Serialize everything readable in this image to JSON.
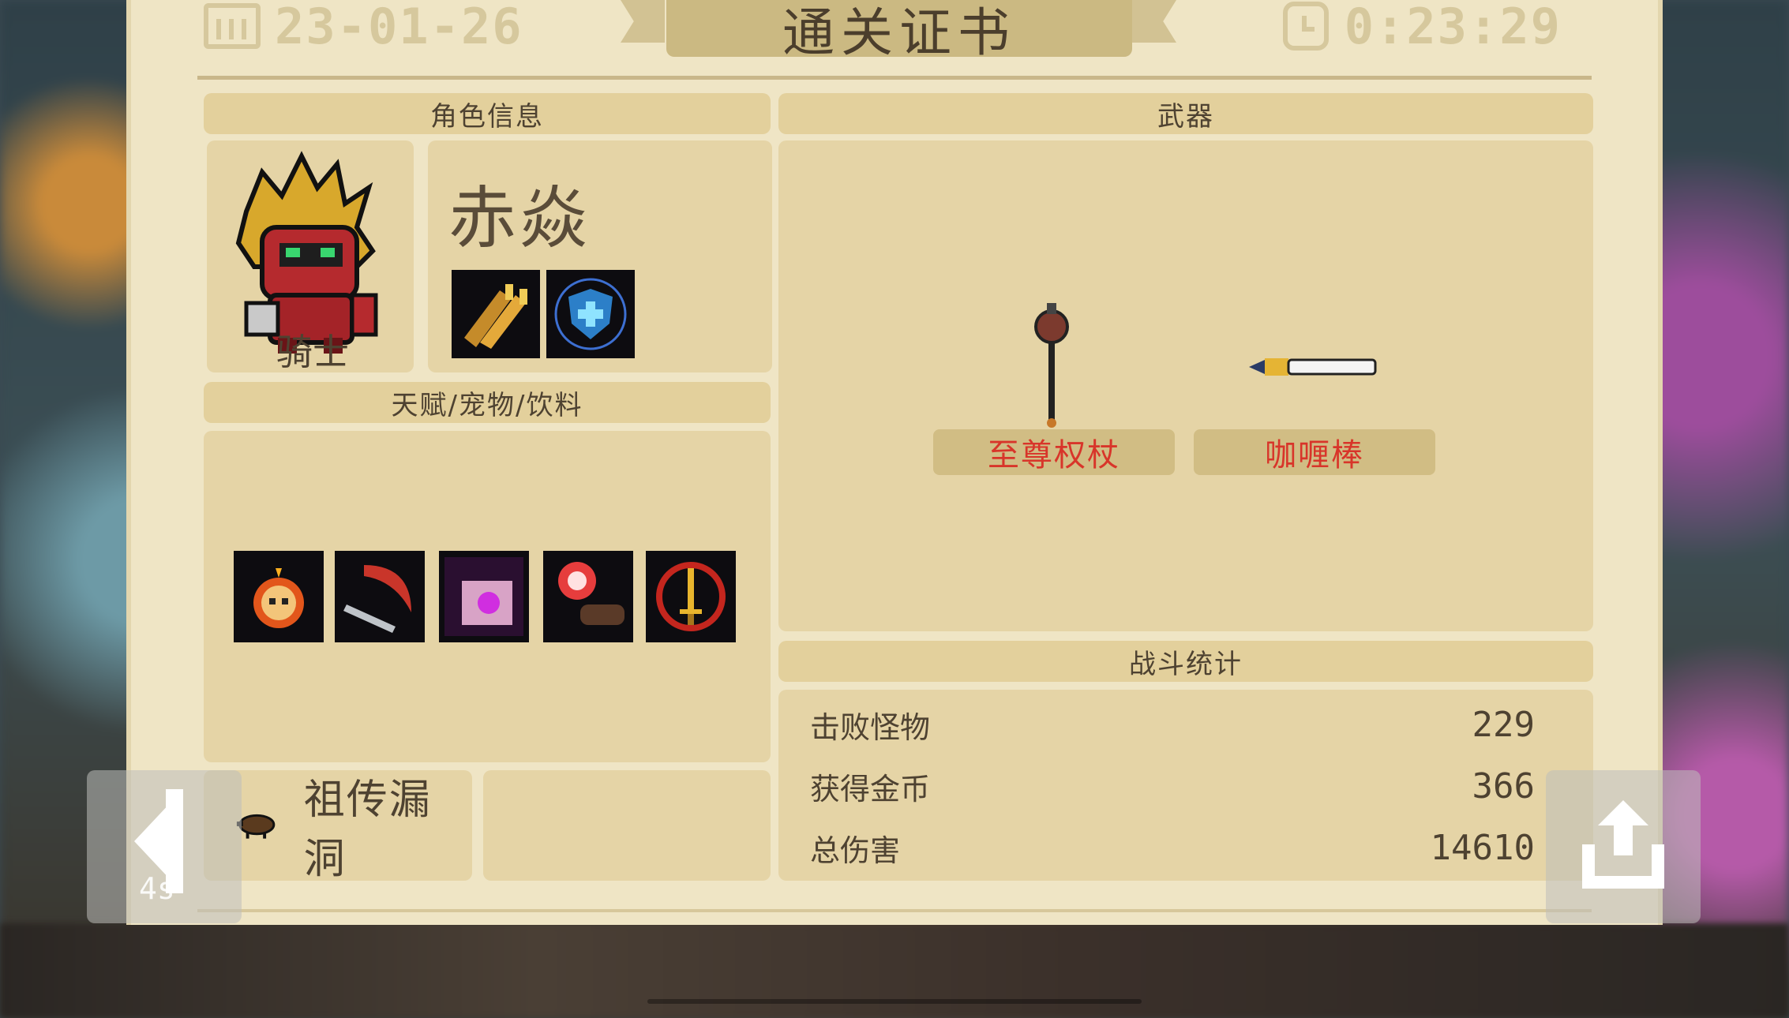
{
  "header": {
    "date": "23-01-26",
    "title": "通关证书",
    "time": "0:23:29"
  },
  "character_panel": {
    "heading": "角色信息",
    "class_name": "骑士",
    "char_name": "赤焱",
    "skills": [
      "twin-guns-skill-icon",
      "shield-skill-icon"
    ]
  },
  "talent_panel": {
    "heading": "天赋/宠物/饮料",
    "items": [
      "flaming-skull-icon",
      "scythe-icon",
      "magic-scroll-icon",
      "cannon-icon",
      "golden-sword-icon"
    ]
  },
  "weapon_panel": {
    "heading": "武器",
    "weapons": [
      {
        "name": "至尊权杖",
        "icon": "scepter-icon"
      },
      {
        "name": "咖喱棒",
        "icon": "sword-icon"
      }
    ]
  },
  "stats_panel": {
    "heading": "战斗统计",
    "rows": [
      {
        "label": "击败怪物",
        "value": "229"
      },
      {
        "label": "获得金币",
        "value": "366"
      },
      {
        "label": "总伤害",
        "value": "14610"
      }
    ]
  },
  "footer": {
    "bug_label": "祖传漏洞",
    "countdown": "4s"
  },
  "colors": {
    "paper": "#efe5c5",
    "panel": "#e5d4a6",
    "label_bar": "#d1bd84",
    "weapon_name": "#d8352a",
    "text": "#4e4231"
  }
}
